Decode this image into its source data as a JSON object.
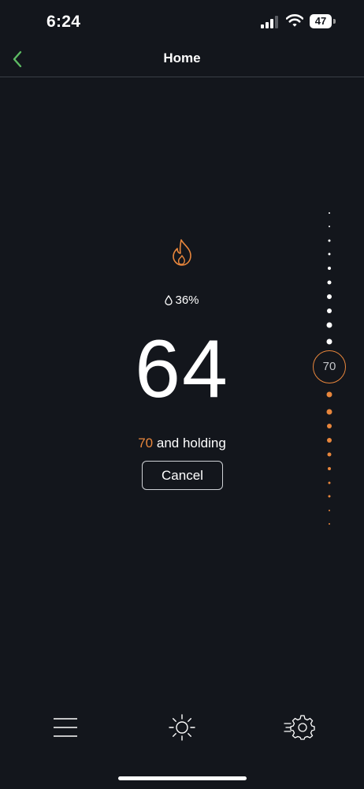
{
  "status_bar": {
    "time": "6:24",
    "battery": "47"
  },
  "nav": {
    "title": "Home",
    "back_icon": "chevron-left-icon"
  },
  "thermostat": {
    "mode_icon": "flame-icon",
    "humidity": "36%",
    "current_temperature": "64",
    "setpoint": "70",
    "hold_text": "and holding",
    "cancel_label": "Cancel"
  },
  "dial": {
    "setpoint_label": "70"
  },
  "bottom_nav": {
    "tabs": [
      {
        "icon": "menu-icon"
      },
      {
        "icon": "sun-icon"
      },
      {
        "icon": "settings-icon"
      }
    ]
  },
  "colors": {
    "background": "#13161c",
    "accent_heat": "#e8863c",
    "back_green": "#5dbb63",
    "text": "#ffffff"
  }
}
